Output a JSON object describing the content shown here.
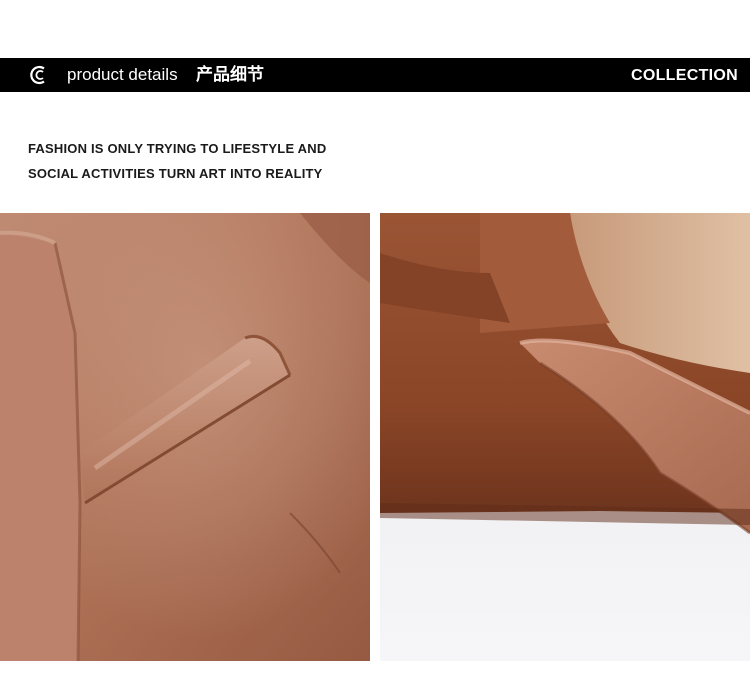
{
  "banner": {
    "logo_icon": "c-monogram-icon",
    "title_en": "product details",
    "title_cn": "产品细节",
    "right_label": "COLLECTION",
    "background": "#000000",
    "text_color": "#ffffff"
  },
  "tagline": {
    "line1": "FASHION IS ONLY TRYING TO LIFESTYLE AND",
    "line2": "SOCIAL ACTIVITIES TURN ART INTO REALITY"
  },
  "photos": {
    "left_color": "#b5775c",
    "right_color": "#8e4a2e"
  }
}
